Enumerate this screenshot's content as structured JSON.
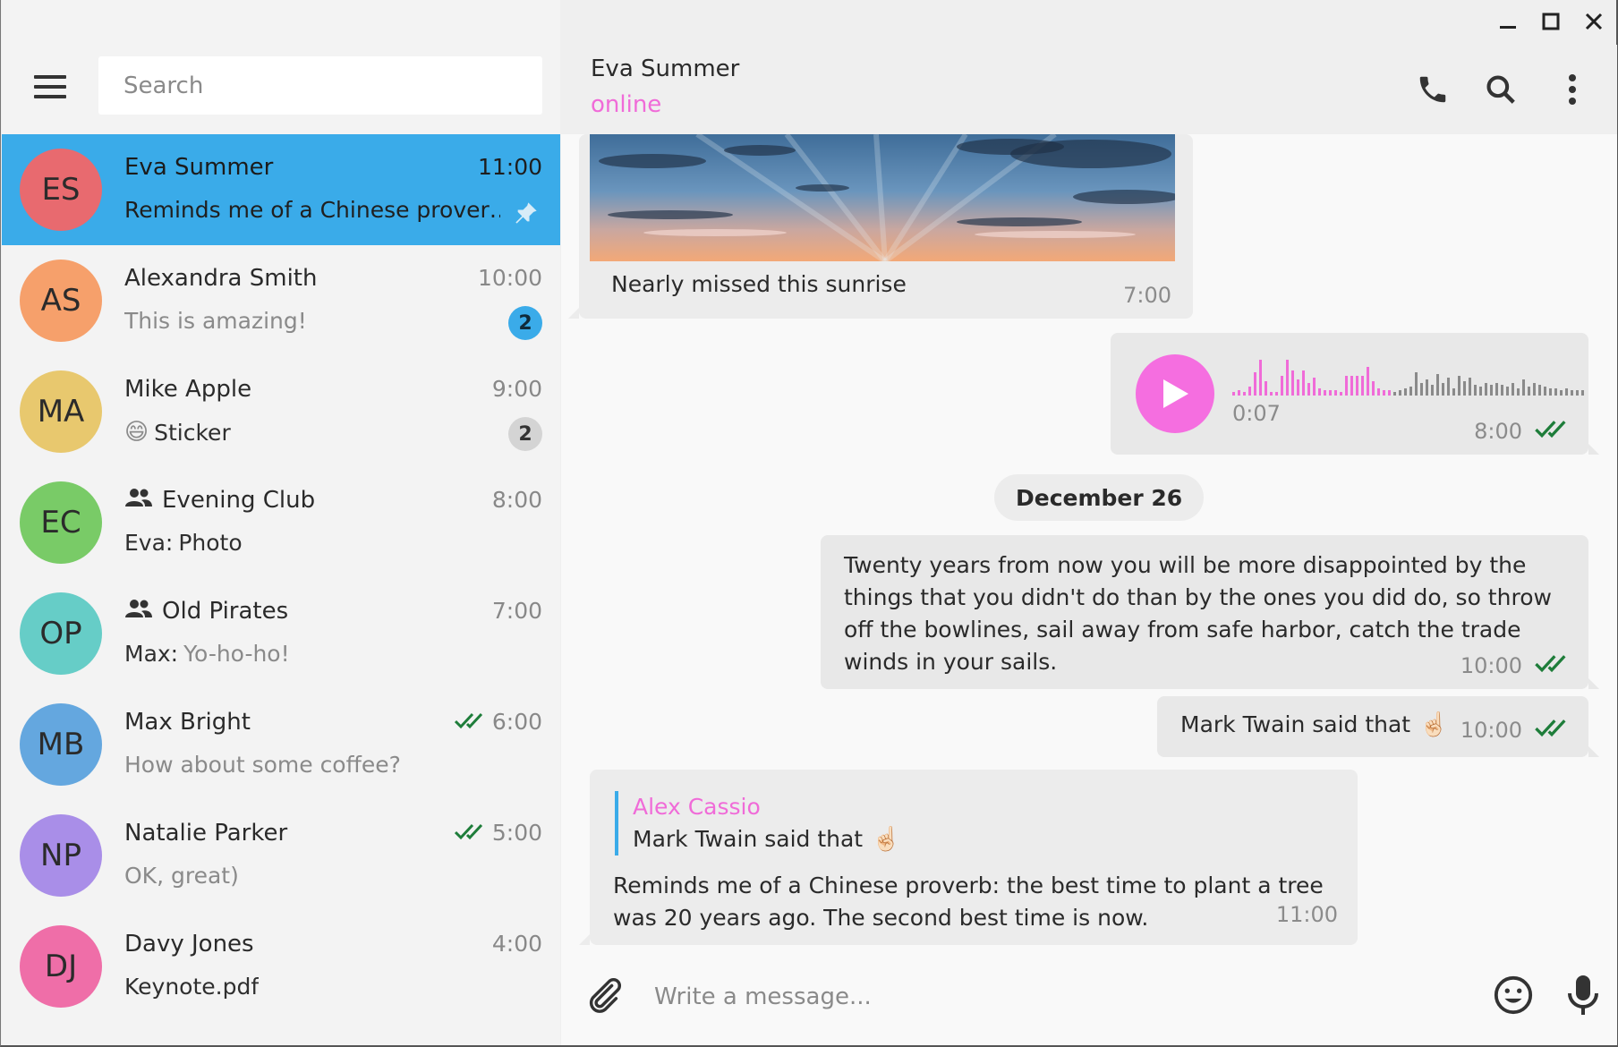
{
  "window": {
    "minimize_icon": "minimize-icon",
    "maximize_icon": "maximize-icon",
    "close_icon": "close-icon"
  },
  "search": {
    "placeholder": "Search"
  },
  "colors": {
    "accent": "#3aabe9",
    "pink": "#f06bd8",
    "check_green": "#1e7d3a"
  },
  "chats": [
    {
      "initials": "ES",
      "name": "Eva Summer",
      "time": "11:00",
      "preview": "Reminds me of a Chinese prover…",
      "avatar_color": "#e86a6f",
      "pinned": true
    },
    {
      "initials": "AS",
      "name": "Alexandra Smith",
      "time": "10:00",
      "preview": "This is amazing!",
      "avatar_color": "#f6a06b",
      "unread": "2"
    },
    {
      "initials": "MA",
      "name": "Mike Apple",
      "time": "9:00",
      "preview": "Sticker",
      "preview_emoji": "😄",
      "avatar_color": "#e8c86e",
      "unread": "2"
    },
    {
      "initials": "EC",
      "name": "Evening Club",
      "time": "8:00",
      "preview_sender": "Eva:",
      "preview": "Photo",
      "avatar_color": "#79cb67",
      "group": true
    },
    {
      "initials": "OP",
      "name": "Old Pirates",
      "time": "7:00",
      "preview_sender": "Max:",
      "preview": "Yo-ho-ho!",
      "avatar_color": "#66cdc7",
      "group": true
    },
    {
      "initials": "MB",
      "name": "Max Bright",
      "time": "6:00",
      "preview": "How about some coffee?",
      "avatar_color": "#64a7df",
      "read": true
    },
    {
      "initials": "NP",
      "name": "Natalie Parker",
      "time": "5:00",
      "preview": "OK, great)",
      "avatar_color": "#a98ee8",
      "read": true
    },
    {
      "initials": "DJ",
      "name": "Davy Jones",
      "time": "4:00",
      "preview": "Keynote.pdf",
      "avatar_color": "#ef6ea8"
    }
  ],
  "header": {
    "name": "Eva Summer",
    "status": "online"
  },
  "messages": {
    "photo_caption": "Nearly missed this sunrise",
    "photo_time": "7:00",
    "voice_duration": "0:07",
    "voice_time": "8:00",
    "date_separator": "December 26",
    "quote_text": "Twenty years from now you will be more disappointed by the things that you didn't do than by the ones you did do, so throw off the bowlines, sail away from safe harbor, catch the trade winds in your sails.",
    "quote_time": "10:00",
    "twain_text": "Mark Twain said that",
    "twain_emoji": "☝🏻",
    "twain_time": "10:00",
    "reply_author": "Alex Cassio",
    "reply_quote": "Mark Twain said that",
    "reply_emoji": "☝🏻",
    "reply_text": "Reminds me of a Chinese proverb: the best time to plant a tree was 20 years ago. The second best time is now.",
    "reply_time": "11:00"
  },
  "composer": {
    "placeholder": "Write a message..."
  }
}
